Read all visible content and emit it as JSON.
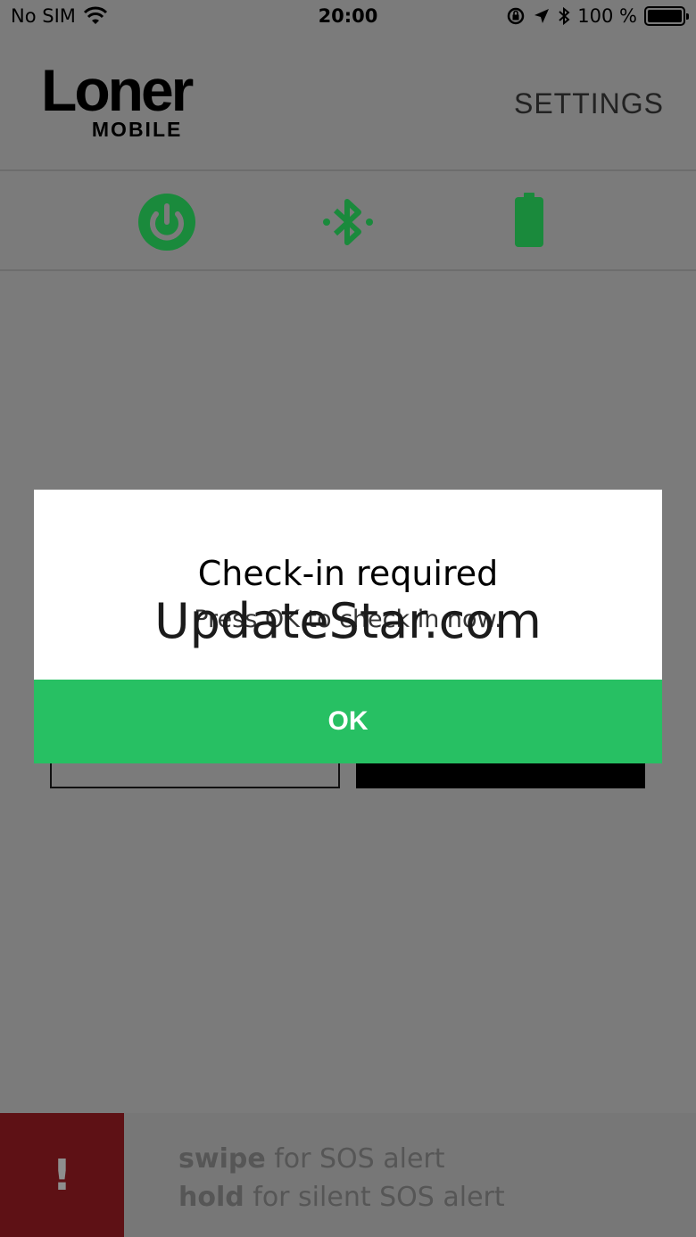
{
  "status_bar": {
    "carrier": "No SIM",
    "time": "20:00",
    "battery_percent": "100 %"
  },
  "header": {
    "logo_main": "Loner",
    "logo_sub": "MOBILE",
    "settings_label": "SETTINGS"
  },
  "icons": [
    "power-icon",
    "bluetooth-icon",
    "battery-icon"
  ],
  "colors": {
    "accent_green": "#27c063",
    "icon_green": "#1a8a3c",
    "sos_red": "#5e1115"
  },
  "sos": {
    "handle_symbol": "!",
    "line1_bold": "swipe",
    "line1_rest": " for SOS alert",
    "line2_bold": "hold",
    "line2_rest": " for silent SOS alert"
  },
  "dialog": {
    "title": "Check-in required",
    "message": "Press OK to check in now.",
    "ok_label": "OK"
  },
  "watermark": "UpdateStar.com"
}
